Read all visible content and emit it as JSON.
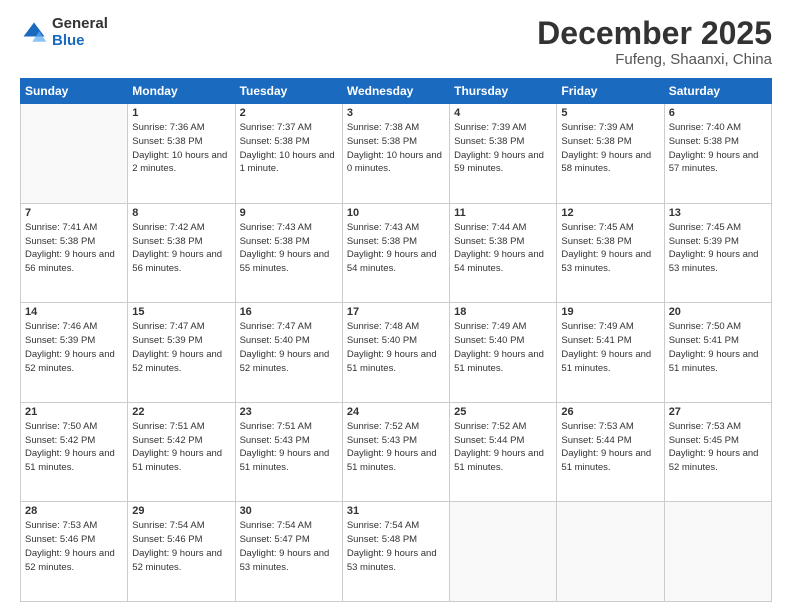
{
  "logo": {
    "general": "General",
    "blue": "Blue"
  },
  "header": {
    "month": "December 2025",
    "location": "Fufeng, Shaanxi, China"
  },
  "weekdays": [
    "Sunday",
    "Monday",
    "Tuesday",
    "Wednesday",
    "Thursday",
    "Friday",
    "Saturday"
  ],
  "weeks": [
    [
      {
        "day": "",
        "info": ""
      },
      {
        "day": "1",
        "info": "Sunrise: 7:36 AM\nSunset: 5:38 PM\nDaylight: 10 hours\nand 2 minutes."
      },
      {
        "day": "2",
        "info": "Sunrise: 7:37 AM\nSunset: 5:38 PM\nDaylight: 10 hours\nand 1 minute."
      },
      {
        "day": "3",
        "info": "Sunrise: 7:38 AM\nSunset: 5:38 PM\nDaylight: 10 hours\nand 0 minutes."
      },
      {
        "day": "4",
        "info": "Sunrise: 7:39 AM\nSunset: 5:38 PM\nDaylight: 9 hours\nand 59 minutes."
      },
      {
        "day": "5",
        "info": "Sunrise: 7:39 AM\nSunset: 5:38 PM\nDaylight: 9 hours\nand 58 minutes."
      },
      {
        "day": "6",
        "info": "Sunrise: 7:40 AM\nSunset: 5:38 PM\nDaylight: 9 hours\nand 57 minutes."
      }
    ],
    [
      {
        "day": "7",
        "info": "Sunrise: 7:41 AM\nSunset: 5:38 PM\nDaylight: 9 hours\nand 56 minutes."
      },
      {
        "day": "8",
        "info": "Sunrise: 7:42 AM\nSunset: 5:38 PM\nDaylight: 9 hours\nand 56 minutes."
      },
      {
        "day": "9",
        "info": "Sunrise: 7:43 AM\nSunset: 5:38 PM\nDaylight: 9 hours\nand 55 minutes."
      },
      {
        "day": "10",
        "info": "Sunrise: 7:43 AM\nSunset: 5:38 PM\nDaylight: 9 hours\nand 54 minutes."
      },
      {
        "day": "11",
        "info": "Sunrise: 7:44 AM\nSunset: 5:38 PM\nDaylight: 9 hours\nand 54 minutes."
      },
      {
        "day": "12",
        "info": "Sunrise: 7:45 AM\nSunset: 5:38 PM\nDaylight: 9 hours\nand 53 minutes."
      },
      {
        "day": "13",
        "info": "Sunrise: 7:45 AM\nSunset: 5:39 PM\nDaylight: 9 hours\nand 53 minutes."
      }
    ],
    [
      {
        "day": "14",
        "info": "Sunrise: 7:46 AM\nSunset: 5:39 PM\nDaylight: 9 hours\nand 52 minutes."
      },
      {
        "day": "15",
        "info": "Sunrise: 7:47 AM\nSunset: 5:39 PM\nDaylight: 9 hours\nand 52 minutes."
      },
      {
        "day": "16",
        "info": "Sunrise: 7:47 AM\nSunset: 5:40 PM\nDaylight: 9 hours\nand 52 minutes."
      },
      {
        "day": "17",
        "info": "Sunrise: 7:48 AM\nSunset: 5:40 PM\nDaylight: 9 hours\nand 51 minutes."
      },
      {
        "day": "18",
        "info": "Sunrise: 7:49 AM\nSunset: 5:40 PM\nDaylight: 9 hours\nand 51 minutes."
      },
      {
        "day": "19",
        "info": "Sunrise: 7:49 AM\nSunset: 5:41 PM\nDaylight: 9 hours\nand 51 minutes."
      },
      {
        "day": "20",
        "info": "Sunrise: 7:50 AM\nSunset: 5:41 PM\nDaylight: 9 hours\nand 51 minutes."
      }
    ],
    [
      {
        "day": "21",
        "info": "Sunrise: 7:50 AM\nSunset: 5:42 PM\nDaylight: 9 hours\nand 51 minutes."
      },
      {
        "day": "22",
        "info": "Sunrise: 7:51 AM\nSunset: 5:42 PM\nDaylight: 9 hours\nand 51 minutes."
      },
      {
        "day": "23",
        "info": "Sunrise: 7:51 AM\nSunset: 5:43 PM\nDaylight: 9 hours\nand 51 minutes."
      },
      {
        "day": "24",
        "info": "Sunrise: 7:52 AM\nSunset: 5:43 PM\nDaylight: 9 hours\nand 51 minutes."
      },
      {
        "day": "25",
        "info": "Sunrise: 7:52 AM\nSunset: 5:44 PM\nDaylight: 9 hours\nand 51 minutes."
      },
      {
        "day": "26",
        "info": "Sunrise: 7:53 AM\nSunset: 5:44 PM\nDaylight: 9 hours\nand 51 minutes."
      },
      {
        "day": "27",
        "info": "Sunrise: 7:53 AM\nSunset: 5:45 PM\nDaylight: 9 hours\nand 52 minutes."
      }
    ],
    [
      {
        "day": "28",
        "info": "Sunrise: 7:53 AM\nSunset: 5:46 PM\nDaylight: 9 hours\nand 52 minutes."
      },
      {
        "day": "29",
        "info": "Sunrise: 7:54 AM\nSunset: 5:46 PM\nDaylight: 9 hours\nand 52 minutes."
      },
      {
        "day": "30",
        "info": "Sunrise: 7:54 AM\nSunset: 5:47 PM\nDaylight: 9 hours\nand 53 minutes."
      },
      {
        "day": "31",
        "info": "Sunrise: 7:54 AM\nSunset: 5:48 PM\nDaylight: 9 hours\nand 53 minutes."
      },
      {
        "day": "",
        "info": ""
      },
      {
        "day": "",
        "info": ""
      },
      {
        "day": "",
        "info": ""
      }
    ]
  ]
}
